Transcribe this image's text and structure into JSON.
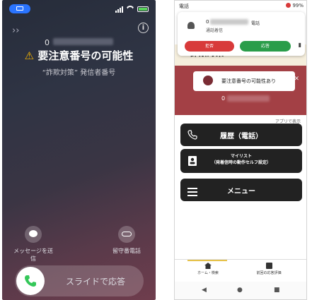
{
  "iphone": {
    "caller_number": "0",
    "warning_text": "要注意番号の可能性",
    "warning_icon": "warning-triangle-icon",
    "subtitle": "“詐欺対策” 発信者番号",
    "message_label": "メッセージを送信",
    "voicemail_label": "留守番電話",
    "slide_text": "スライドで応答",
    "colors": {
      "accent": "#2a74ff",
      "warning": "#f5b400",
      "answer": "#34c759"
    }
  },
  "android": {
    "status_left": "電話",
    "status_right": "99%",
    "notif_number": "0",
    "notif_number_tag": "電話",
    "notif_sub": "通話着信",
    "decline_label": "拒否",
    "answer_label": "応答",
    "app_logo": "詐欺対策",
    "logo_by": "by",
    "logo_brand": "NTTドコモページ",
    "alert_text": "要注意番号の可能性あり",
    "alert_number": "0",
    "ad_line": "アプリで表示",
    "menu": [
      {
        "label": "履歴（電話）"
      },
      {
        "label": "マイリスト\n（発着信時の動作セルフ設定）"
      },
      {
        "label": "メニュー"
      }
    ],
    "bottom_nav": [
      {
        "label": "ホーム・検索"
      },
      {
        "label": "前回の応答評価"
      }
    ],
    "colors": {
      "decline": "#d83a3a",
      "answer": "#2a9d4a",
      "alert_band": "#a34045",
      "menu_bg": "#222222"
    }
  }
}
